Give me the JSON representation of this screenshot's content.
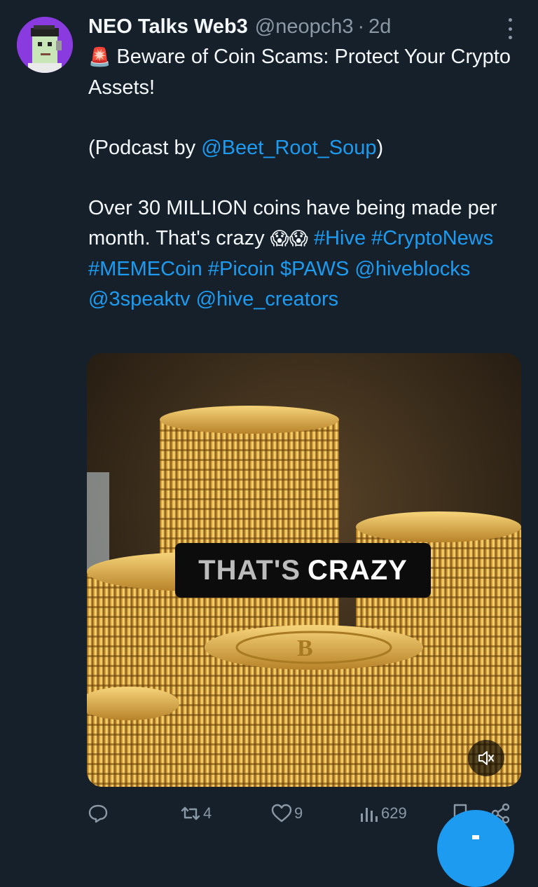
{
  "tweet": {
    "author_name": "NEO Talks Web3",
    "author_handle": "@neopch3",
    "separator": "·",
    "time": "2d",
    "line1_emoji": "🚨",
    "line1_text": " Beware of Coin Scams: Protect Your Crypto Assets!",
    "podcast_prefix": "(Podcast by ",
    "podcast_mention": "@Beet_Root_Soup",
    "podcast_suffix": ")",
    "body_text": "Over 30 MILLION coins have being made per month. That's crazy ",
    "body_emoji": "😱😱",
    "tag_hive": "#Hive",
    "tag_cryptonews": "#CryptoNews",
    "tag_memecoin": "#MEMECoin",
    "tag_picoin": "#Picoin",
    "cashtag_paws": "$PAWS",
    "mention_hiveblocks": "@hiveblocks",
    "mention_3speaktv": "@3speaktv",
    "mention_hive_creators": "@hive_creators"
  },
  "media": {
    "caption_part1": "THAT'S",
    "caption_part2": "CRAZY",
    "mute_icon": "speaker-muted-icon"
  },
  "actions": {
    "reply_count": "",
    "retweet_count": "4",
    "like_count": "9",
    "views_count": "629"
  },
  "colors": {
    "background": "#15202b",
    "text": "#f5f8fa",
    "muted": "#8b98a5",
    "link": "#1d9bf0"
  }
}
